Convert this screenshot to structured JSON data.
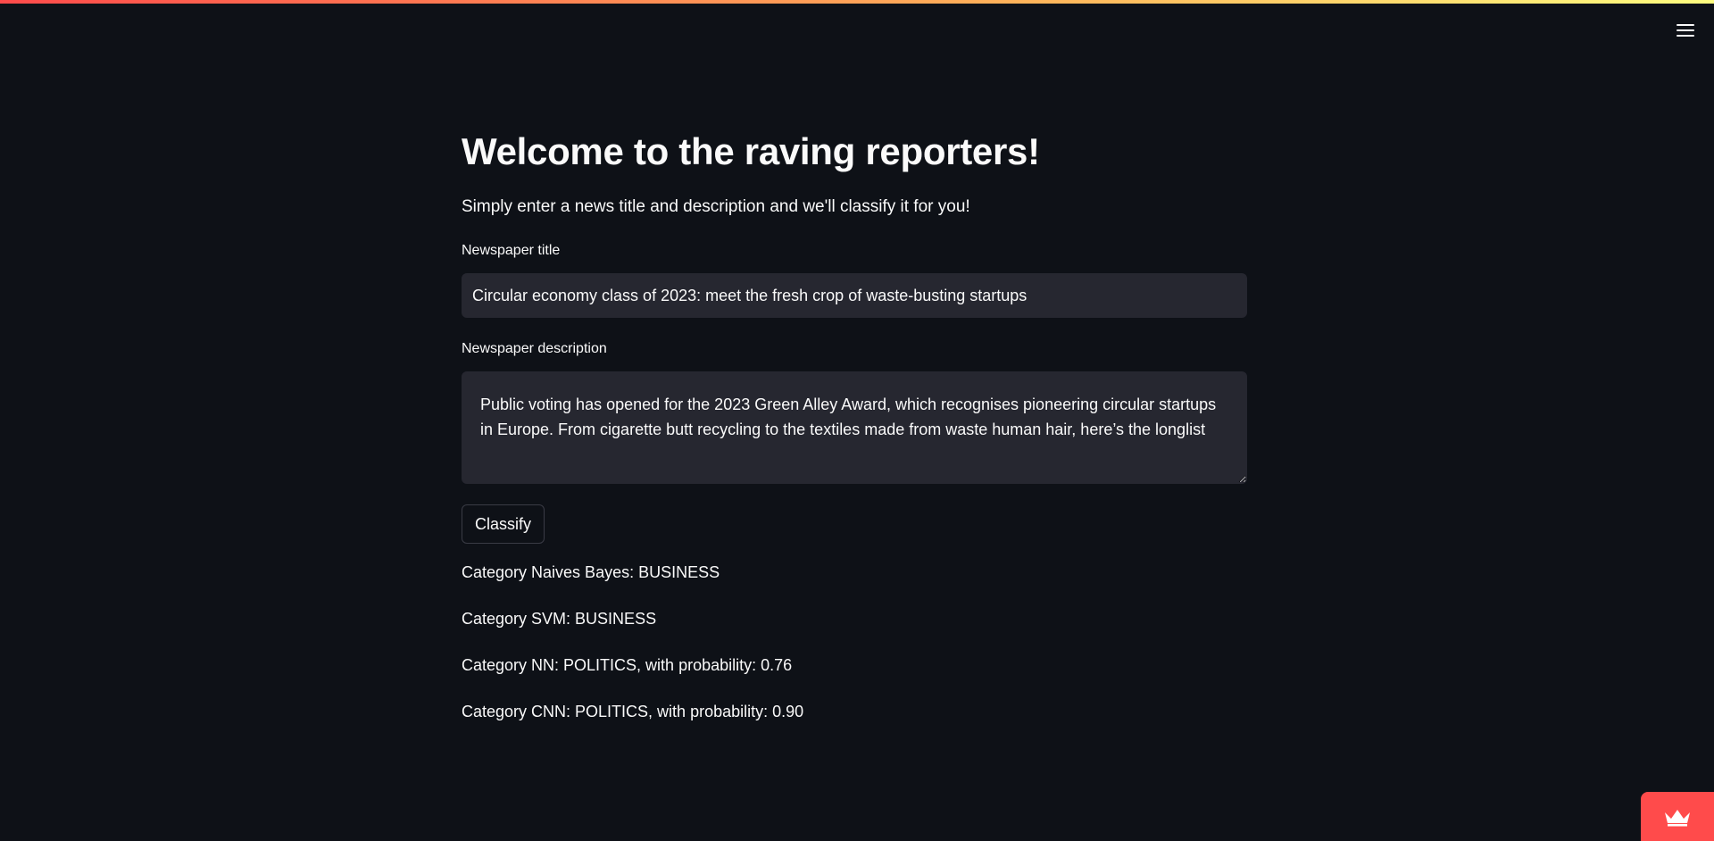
{
  "header": {
    "menu_icon": "hamburger-menu-icon",
    "decoration_colors": [
      "#ff4b4b",
      "#ffb45a",
      "#fffd80"
    ]
  },
  "main": {
    "title": "Welcome to the raving reporters!",
    "subtitle": "Simply enter a news title and description and we'll classify it for you!",
    "title_field": {
      "label": "Newspaper title",
      "value": "Circular economy class of 2023: meet the fresh crop of waste-busting startups"
    },
    "description_field": {
      "label": "Newspaper description",
      "value": "Public voting has opened for the 2023 Green Alley Award, which recognises pioneering circular startups in Europe. From cigarette butt recycling to the textiles made from waste human hair, here’s the longlist"
    },
    "classify_button": "Classify",
    "results": [
      "Category Naives Bayes: BUSINESS",
      "Category SVM: BUSINESS",
      "Category NN: POLITICS, with probability: 0.76",
      "Category CNN: POLITICS, with probability: 0.90"
    ]
  },
  "footer": {
    "badge_icon": "streamlit-crown-icon",
    "badge_color": "#ff4b4b"
  },
  "theme": {
    "background": "#0e1117",
    "input_background": "#262730",
    "text": "#fafafa"
  }
}
